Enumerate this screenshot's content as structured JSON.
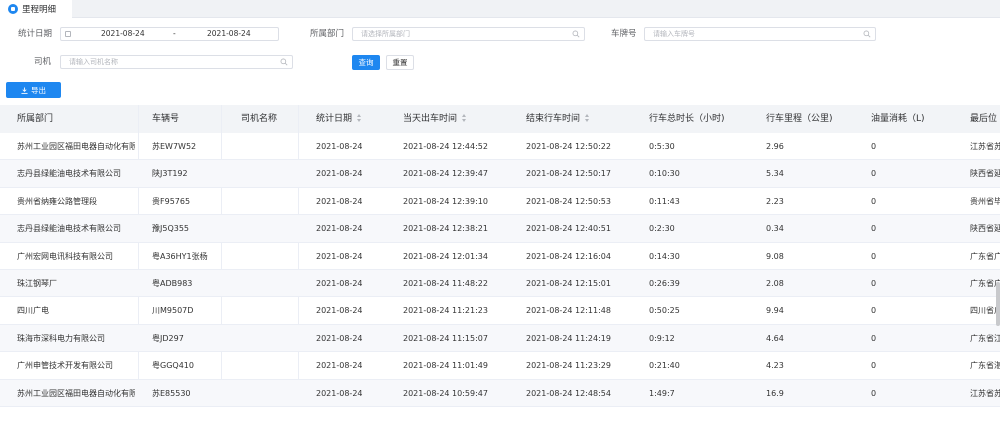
{
  "tab": {
    "label": "里程明细",
    "icon": "report-icon"
  },
  "filters": {
    "date_label": "统计日期",
    "date_start": "2021-08-24",
    "date_sep": "-",
    "date_end": "2021-08-24",
    "dept_label": "所属部门",
    "dept_placeholder": "请选择所属部门",
    "plate_label": "车牌号",
    "plate_placeholder": "请输入车牌号",
    "driver_label": "司机",
    "driver_placeholder": "请输入司机名称",
    "query_button": "查询",
    "reset_button": "重置"
  },
  "toolbar": {
    "export_button": "导出"
  },
  "colors": {
    "primary": "#1e87f0",
    "header_bg": "#f2f4f7"
  },
  "table": {
    "columns": [
      "所属部门",
      "车辆号",
      "司机名称",
      "统计日期",
      "当天出车时间",
      "结束行车时间",
      "行车总时长（小时)",
      "行车里程（公里)",
      "油量消耗（L)",
      "最后位"
    ],
    "rows": [
      [
        "苏州工业园区福田电器自动化有限",
        "苏EW7W52",
        "",
        "2021-08-24",
        "2021-08-24 12:44:52",
        "2021-08-24 12:50:22",
        "0:5:30",
        "2.96",
        "0",
        "江苏省苏"
      ],
      [
        "志丹县绿能油电技术有限公司",
        "陕J3T192",
        "",
        "2021-08-24",
        "2021-08-24 12:39:47",
        "2021-08-24 12:50:17",
        "0:10:30",
        "5.34",
        "0",
        "陕西省延"
      ],
      [
        "贵州省纳雍公路管理段",
        "贵F95765",
        "",
        "2021-08-24",
        "2021-08-24 12:39:10",
        "2021-08-24 12:50:53",
        "0:11:43",
        "2.23",
        "0",
        "贵州省毕"
      ],
      [
        "志丹县绿能油电技术有限公司",
        "豫J5Q355",
        "",
        "2021-08-24",
        "2021-08-24 12:38:21",
        "2021-08-24 12:40:51",
        "0:2:30",
        "0.34",
        "0",
        "陕西省延"
      ],
      [
        "广州宏网电讯科技有限公司",
        "粤A36HY1张杨",
        "",
        "2021-08-24",
        "2021-08-24 12:01:34",
        "2021-08-24 12:16:04",
        "0:14:30",
        "9.08",
        "0",
        "广东省广"
      ],
      [
        "珠江钢琴厂",
        "粤ADB983",
        "",
        "2021-08-24",
        "2021-08-24 11:48:22",
        "2021-08-24 12:15:01",
        "0:26:39",
        "2.08",
        "0",
        "广东省广"
      ],
      [
        "四川广电",
        "川M9507D",
        "",
        "2021-08-24",
        "2021-08-24 11:21:23",
        "2021-08-24 12:11:48",
        "0:50:25",
        "9.94",
        "0",
        "四川省广"
      ],
      [
        "珠海市深科电力有限公司",
        "粤JD297",
        "",
        "2021-08-24",
        "2021-08-24 11:15:07",
        "2021-08-24 11:24:19",
        "0:9:12",
        "4.64",
        "0",
        "广东省江"
      ],
      [
        "广州申管技术开发有限公司",
        "粤GGQ410",
        "",
        "2021-08-24",
        "2021-08-24 11:01:49",
        "2021-08-24 11:23:29",
        "0:21:40",
        "4.23",
        "0",
        "广东省湛"
      ],
      [
        "苏州工业园区福田电器自动化有限",
        "苏E85530",
        "",
        "2021-08-24",
        "2021-08-24 10:59:47",
        "2021-08-24 12:48:54",
        "1:49:7",
        "16.9",
        "0",
        "江苏省苏"
      ]
    ]
  }
}
